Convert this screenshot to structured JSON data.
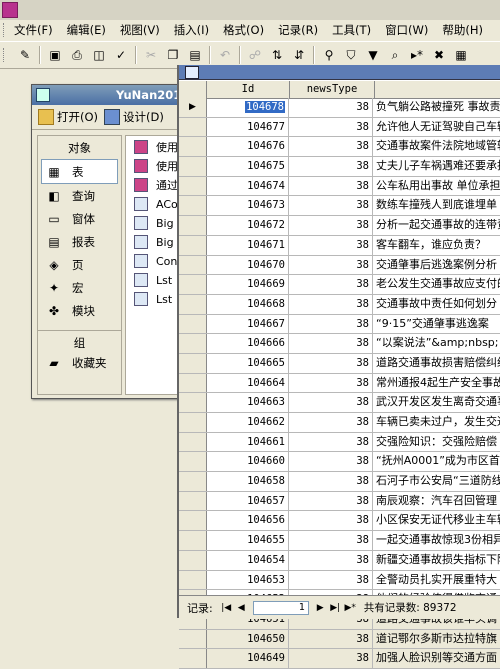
{
  "menubar": {
    "items": [
      "文件(F)",
      "编辑(E)",
      "视图(V)",
      "插入(I)",
      "格式(O)",
      "记录(R)",
      "工具(T)",
      "窗口(W)",
      "帮助(H)"
    ]
  },
  "db_window": {
    "title": "YuNan2012",
    "open_label": "打开(O)",
    "design_label": "设计(D)",
    "objects_header": "对象",
    "objects": [
      "表",
      "查询",
      "窗体",
      "报表",
      "页",
      "宏",
      "模块"
    ],
    "groups_header": "组",
    "favorites_label": "收藏夹",
    "items": [
      {
        "label": "使用",
        "icon": "query-icon"
      },
      {
        "label": "使用",
        "icon": "query-icon"
      },
      {
        "label": "通过",
        "icon": "query-icon"
      },
      {
        "label": "ACo",
        "icon": "table-icon"
      },
      {
        "label": "Big",
        "icon": "table-icon"
      },
      {
        "label": "Big",
        "icon": "table-icon"
      },
      {
        "label": "Con",
        "icon": "table-icon"
      },
      {
        "label": "Lst",
        "icon": "table-icon"
      },
      {
        "label": "Lst",
        "icon": "table-icon"
      }
    ]
  },
  "table": {
    "columns": [
      "Id",
      "newsType"
    ],
    "rows": [
      {
        "id": "104678",
        "type": "38",
        "title": "负气躺公路被撞死 事故责"
      },
      {
        "id": "104677",
        "type": "38",
        "title": "允许他人无证驾驶自己车辆"
      },
      {
        "id": "104676",
        "type": "38",
        "title": "交通事故案件法院地域管辖"
      },
      {
        "id": "104675",
        "type": "38",
        "title": "丈夫儿子车祸遇难还要承担"
      },
      {
        "id": "104674",
        "type": "38",
        "title": "公车私用出事故 单位承担"
      },
      {
        "id": "104673",
        "type": "38",
        "title": "数练车撞残人到底谁埋单"
      },
      {
        "id": "104672",
        "type": "38",
        "title": "分析一起交通事故的连带责任"
      },
      {
        "id": "104671",
        "type": "38",
        "title": "客车翻车，谁应负责？"
      },
      {
        "id": "104670",
        "type": "38",
        "title": "交通肇事后逃逸案例分析"
      },
      {
        "id": "104669",
        "type": "38",
        "title": "老公发生交通事故应支付的"
      },
      {
        "id": "104668",
        "type": "38",
        "title": "交通事故中责任如何划分"
      },
      {
        "id": "104667",
        "type": "38",
        "title": "“9·15”交通肇事逃逸案"
      },
      {
        "id": "104666",
        "type": "38",
        "title": "“以案说法”&amp;nbsp;"
      },
      {
        "id": "104665",
        "type": "38",
        "title": "道路交通事故损害赔偿纠纷"
      },
      {
        "id": "104664",
        "type": "38",
        "title": "常州通报4起生产安全事故"
      },
      {
        "id": "104663",
        "type": "38",
        "title": "武汉开发区发生离奇交通事故"
      },
      {
        "id": "104662",
        "type": "38",
        "title": "车辆已卖未过户，发生交通"
      },
      {
        "id": "104661",
        "type": "38",
        "title": "交强险知识：交强险赔偿"
      },
      {
        "id": "104660",
        "type": "38",
        "title": "“抚州A0001”成为市区首"
      },
      {
        "id": "104658",
        "type": "38",
        "title": "石河子市公安局“三道防线"
      },
      {
        "id": "104657",
        "type": "38",
        "title": "南辰观察：汽车召回管理"
      },
      {
        "id": "104656",
        "type": "38",
        "title": "小区保安无证代移业主车辆"
      },
      {
        "id": "104655",
        "type": "38",
        "title": "一起交通事故惊现3份相异"
      },
      {
        "id": "104654",
        "type": "38",
        "title": "新疆交通事故损失指标下降"
      },
      {
        "id": "104653",
        "type": "38",
        "title": "全警动员扎实开展重特大"
      },
      {
        "id": "104652",
        "type": "38",
        "title": "他们的经验值得借鉴交通"
      },
      {
        "id": "104651",
        "type": "38",
        "title": "道路交通事故该谁率头调"
      },
      {
        "id": "104650",
        "type": "38",
        "title": "道记鄂尔多斯市达拉特旗"
      },
      {
        "id": "104649",
        "type": "38",
        "title": "加强人脸识别等交通方面"
      }
    ]
  },
  "navbar": {
    "record_label": "记录:",
    "current": "1",
    "count_text": "共有记录数: 89372"
  }
}
